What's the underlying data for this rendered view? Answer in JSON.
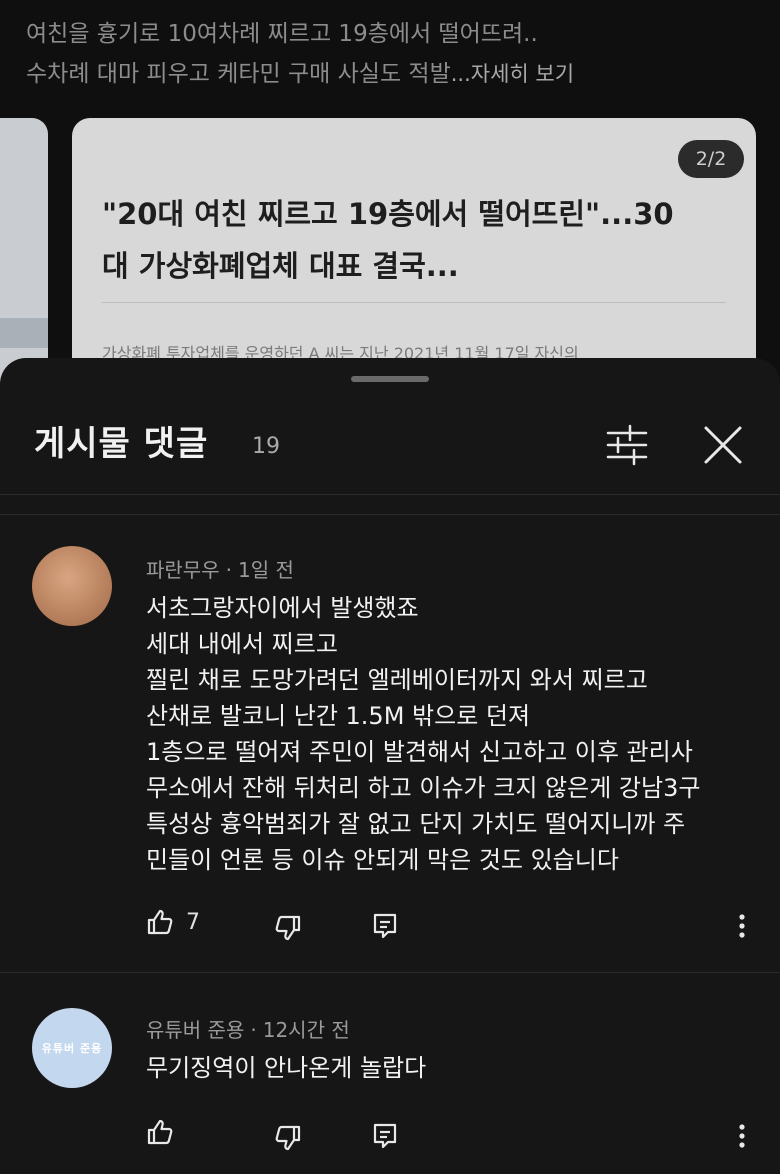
{
  "post": {
    "description_line1": "여친을 흉기로 10여차례 찌르고 19층에서 떨어뜨려..",
    "description_line2": "수차례 대마 피우고 케타민 구매 사실도 적발",
    "more_label": "...자세히 보기",
    "card": {
      "page_indicator": "2/2",
      "headline_line1": "\"20대 여친 찌르고 19층에서 떨어뜨린\"...30",
      "headline_line2": "대 가상화폐업체 대표 결국...",
      "excerpt": "가상화폐 투자업체를 운영하던 A 씨는 지난 2021년 11월 17일 자신의"
    }
  },
  "sheet": {
    "title": "게시물 댓글",
    "count": "19",
    "icons": {
      "filter": "filter-sliders-icon",
      "close": "close-icon"
    }
  },
  "comments": [
    {
      "author": "파란무우",
      "time": "1일 전",
      "avatar": "photo",
      "lines": [
        "서초그랑자이에서 발생했죠",
        "세대 내에서 찌르고",
        "찔린 채로 도망가려던 엘레베이터까지 와서 찌르고",
        "산채로 발코니 난간 1.5M 밖으로 던져",
        "1층으로 떨어져 주민이 발견해서 신고하고 이후 관리사",
        "무소에서 잔해 뒤처리 하고 이슈가 크지 않은게 강남3구",
        "특성상 흉악범죄가 잘 없고 단지 가치도 떨어지니까 주",
        "민들이 언론 등 이슈 안되게 막은 것도 있습니다"
      ],
      "likes": "7"
    },
    {
      "author": "유튜버 준용",
      "time": "12시간 전",
      "avatar_text": "유튜버 준용",
      "lines": [
        "무기징역이 안나온게 놀랍다"
      ],
      "likes": ""
    }
  ],
  "action_icons": [
    "thumbs-up-icon",
    "thumbs-down-icon",
    "reply-icon",
    "more-vertical-icon"
  ],
  "colors": {
    "background": "#0f0f0f",
    "sheet": "#161616",
    "text": "#f1f1f1",
    "muted": "#9a9a9a",
    "card": "#d8d8d8"
  }
}
